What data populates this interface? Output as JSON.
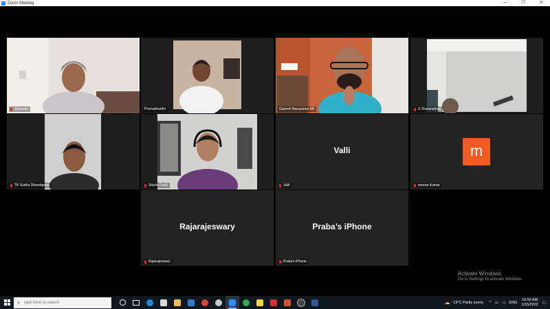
{
  "window": {
    "title": "Zoom Meeting",
    "controls": [
      "—",
      "❐",
      "✕"
    ]
  },
  "participants": [
    {
      "name": "Jayasala",
      "video": true
    },
    {
      "name": "Premabhakthi",
      "video": true,
      "active_speaker": true
    },
    {
      "name": "Ganesh Narayanan AR",
      "video": true
    },
    {
      "name": "S.Viswanathan",
      "video": true
    },
    {
      "name": "TK Sudha Dhandapani",
      "video": true
    },
    {
      "name": "Siksha Dalal",
      "video": true
    },
    {
      "name": "Valli",
      "video": false,
      "display": "Valli"
    },
    {
      "name": "meena Kumar",
      "video": false,
      "avatar_letter": "m",
      "avatar_color": "#f15a22"
    },
    {
      "name": "Rajarajeswary",
      "video": false,
      "display": "Rajarajeswary"
    },
    {
      "name": "Praba's iPhone",
      "video": false,
      "display": "Praba’s iPhone"
    }
  ],
  "watermark": {
    "title": "Activate Windows",
    "subtitle": "Go to Settings to activate Windows."
  },
  "taskbar": {
    "search_placeholder": "Type here to search",
    "weather": "-19°C  Partly sunny",
    "language": "ENG",
    "time": "10:56 AM",
    "date": "1/15/2022"
  },
  "colors": {
    "active_speaker_border": "#b7d94a",
    "muted_mic": "#e02828",
    "avatar_orange": "#f15a22"
  }
}
